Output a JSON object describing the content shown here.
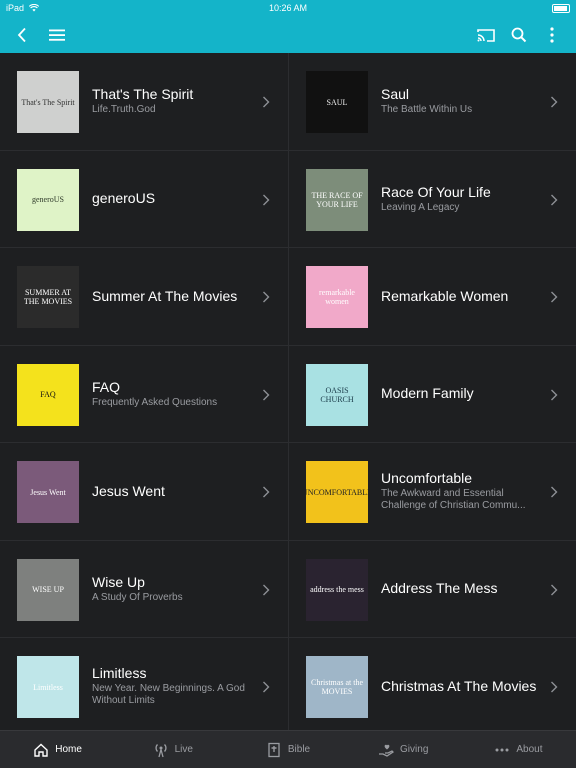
{
  "status": {
    "device": "iPad",
    "time": "10:26 AM"
  },
  "nav": {
    "back_icon": "chevron-left-icon",
    "menu_icon": "hamburger-icon",
    "cast_icon": "cast-icon",
    "search_icon": "search-icon",
    "more_icon": "more-vertical-icon",
    "bar_color": "#14b4c9"
  },
  "items": [
    {
      "title": "That's The Spirit",
      "subtitle": "Life.Truth.God",
      "art_text": "That's The Spirit",
      "art_bg": "#cfd0cf",
      "art_fg": "#333333"
    },
    {
      "title": "Saul",
      "subtitle": "The Battle Within Us",
      "art_text": "SAUL",
      "art_bg": "#111111",
      "art_fg": "#eeeeee"
    },
    {
      "title": "generoUS",
      "subtitle": "",
      "art_text": "generoUS",
      "art_bg": "#dff3c7",
      "art_fg": "#2f3a2a"
    },
    {
      "title": "Race Of Your Life",
      "subtitle": "Leaving A Legacy",
      "art_text": "THE RACE OF YOUR LIFE",
      "art_bg": "#7d8d7a",
      "art_fg": "#ffffff"
    },
    {
      "title": "Summer At The Movies",
      "subtitle": "",
      "art_text": "SUMMER AT THE MOVIES",
      "art_bg": "#2b2b2b",
      "art_fg": "#ffffff"
    },
    {
      "title": "Remarkable Women",
      "subtitle": "",
      "art_text": "remarkable women",
      "art_bg": "#f1a9c9",
      "art_fg": "#ffffff"
    },
    {
      "title": "FAQ",
      "subtitle": "Frequently Asked Questions",
      "art_text": "FAQ",
      "art_bg": "#f4e21c",
      "art_fg": "#111111"
    },
    {
      "title": "Modern Family",
      "subtitle": "",
      "art_text": "OASIS CHURCH",
      "art_bg": "#a9e1e3",
      "art_fg": "#1b3c4a"
    },
    {
      "title": "Jesus Went",
      "subtitle": "",
      "art_text": "Jesus Went",
      "art_bg": "#7b5a7a",
      "art_fg": "#ffffff"
    },
    {
      "title": "Uncomfortable",
      "subtitle": "The Awkward and Essential Challenge of Christian Commu...",
      "art_text": "UNCOMFORTABLE",
      "art_bg": "#f2c21b",
      "art_fg": "#222222"
    },
    {
      "title": "Wise Up",
      "subtitle": "A Study Of Proverbs",
      "art_text": "WISE UP",
      "art_bg": "#7e807e",
      "art_fg": "#ffffff"
    },
    {
      "title": "Address The Mess",
      "subtitle": "",
      "art_text": "address the mess",
      "art_bg": "#2a2330",
      "art_fg": "#ffffff"
    },
    {
      "title": "Limitless",
      "subtitle": "New Year. New Beginnings. A God Without Limits",
      "art_text": "Limitless",
      "art_bg": "#bfe6e9",
      "art_fg": "#ffffff"
    },
    {
      "title": "Christmas At The Movies",
      "subtitle": "",
      "art_text": "Christmas at the MOVIES",
      "art_bg": "#9fb6c8",
      "art_fg": "#ffffff"
    }
  ],
  "tabs": [
    {
      "label": "Home",
      "icon": "home-icon",
      "active": true
    },
    {
      "label": "Live",
      "icon": "broadcast-icon",
      "active": false
    },
    {
      "label": "Bible",
      "icon": "bible-icon",
      "active": false
    },
    {
      "label": "Giving",
      "icon": "giving-hand-icon",
      "active": false
    },
    {
      "label": "About",
      "icon": "more-horizontal-icon",
      "active": false
    }
  ]
}
